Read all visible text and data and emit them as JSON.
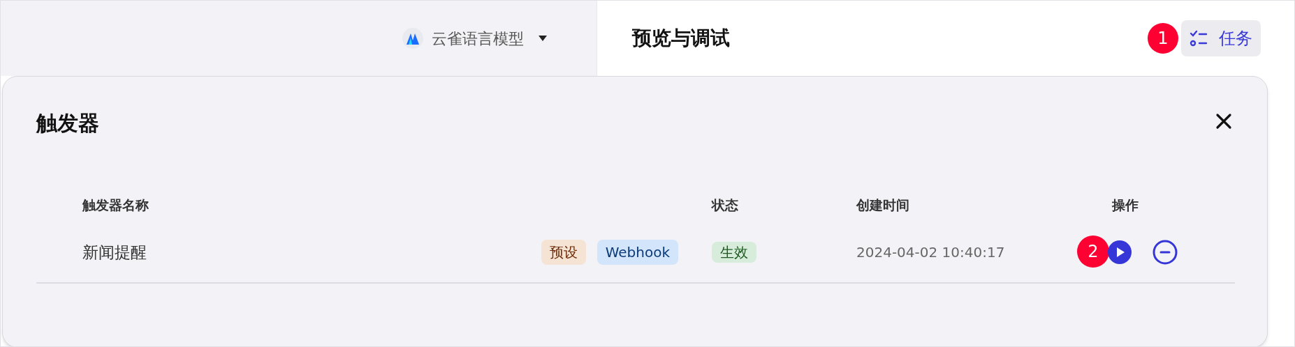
{
  "model_selector": {
    "label": "云雀语言模型"
  },
  "header": {
    "title": "预览与调试",
    "badge": "1",
    "tasks_button": "任务"
  },
  "panel": {
    "title": "触发器",
    "columns": [
      "触发器名称",
      "状态",
      "创建时间",
      "操作"
    ],
    "rows": [
      {
        "name": "新闻提醒",
        "tags": [
          {
            "label": "预设",
            "color": "#f5e3d3"
          },
          {
            "label": "Webhook",
            "color": "#d3e5fa"
          }
        ],
        "status": "生效",
        "created": "2024-04-02 10:40:17",
        "badge": "2"
      }
    ]
  }
}
